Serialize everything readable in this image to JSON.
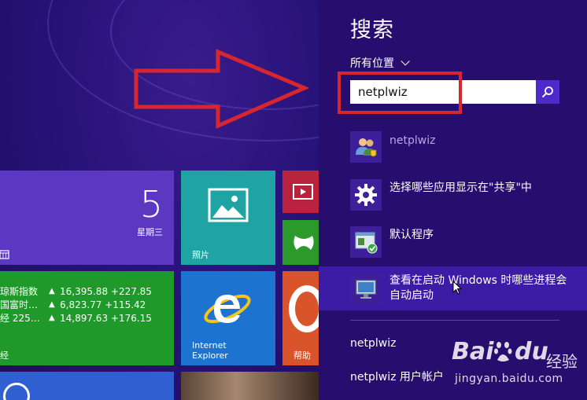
{
  "start_screen": {
    "calendar": {
      "day": "5",
      "weekday": "星期三"
    },
    "photos": {
      "label": "照片"
    },
    "finance": {
      "rows": [
        {
          "name": "琼斯指数",
          "arrow": "▲",
          "value": "16,395.88 +227.85"
        },
        {
          "name": "国富时…",
          "arrow": "▲",
          "value": "6,823.77 +115.42"
        },
        {
          "name": "经 225…",
          "arrow": "▲",
          "value": "14,897.63 +176.15"
        }
      ],
      "label": "经"
    },
    "ie": {
      "label": "Internet\nExplorer"
    },
    "help": {
      "label": "帮助"
    }
  },
  "charm": {
    "title": "搜索",
    "scope": "所有位置",
    "search_value": "netplwiz",
    "results": [
      {
        "text": "netplwiz",
        "icon": "users-icon"
      },
      {
        "text": "选择哪些应用显示在\"共享\"中",
        "icon": "gear-icon"
      },
      {
        "text": "默认程序",
        "icon": "default-programs-icon"
      },
      {
        "text": "查看在启动 Windows 时哪些进程会自动启动",
        "icon": "monitor-icon"
      }
    ],
    "suggestions": [
      {
        "text": "netplwiz"
      },
      {
        "text": "netplwiz 用户帐户"
      }
    ]
  },
  "watermark": {
    "brand": "Bai",
    "du": "du",
    "jingyan": "经验",
    "url": "jingyan.baidu.com"
  },
  "colors": {
    "charm_bg": "#260d6e",
    "accent": "#4e2bc9",
    "annotation_red": "#d8262f"
  }
}
